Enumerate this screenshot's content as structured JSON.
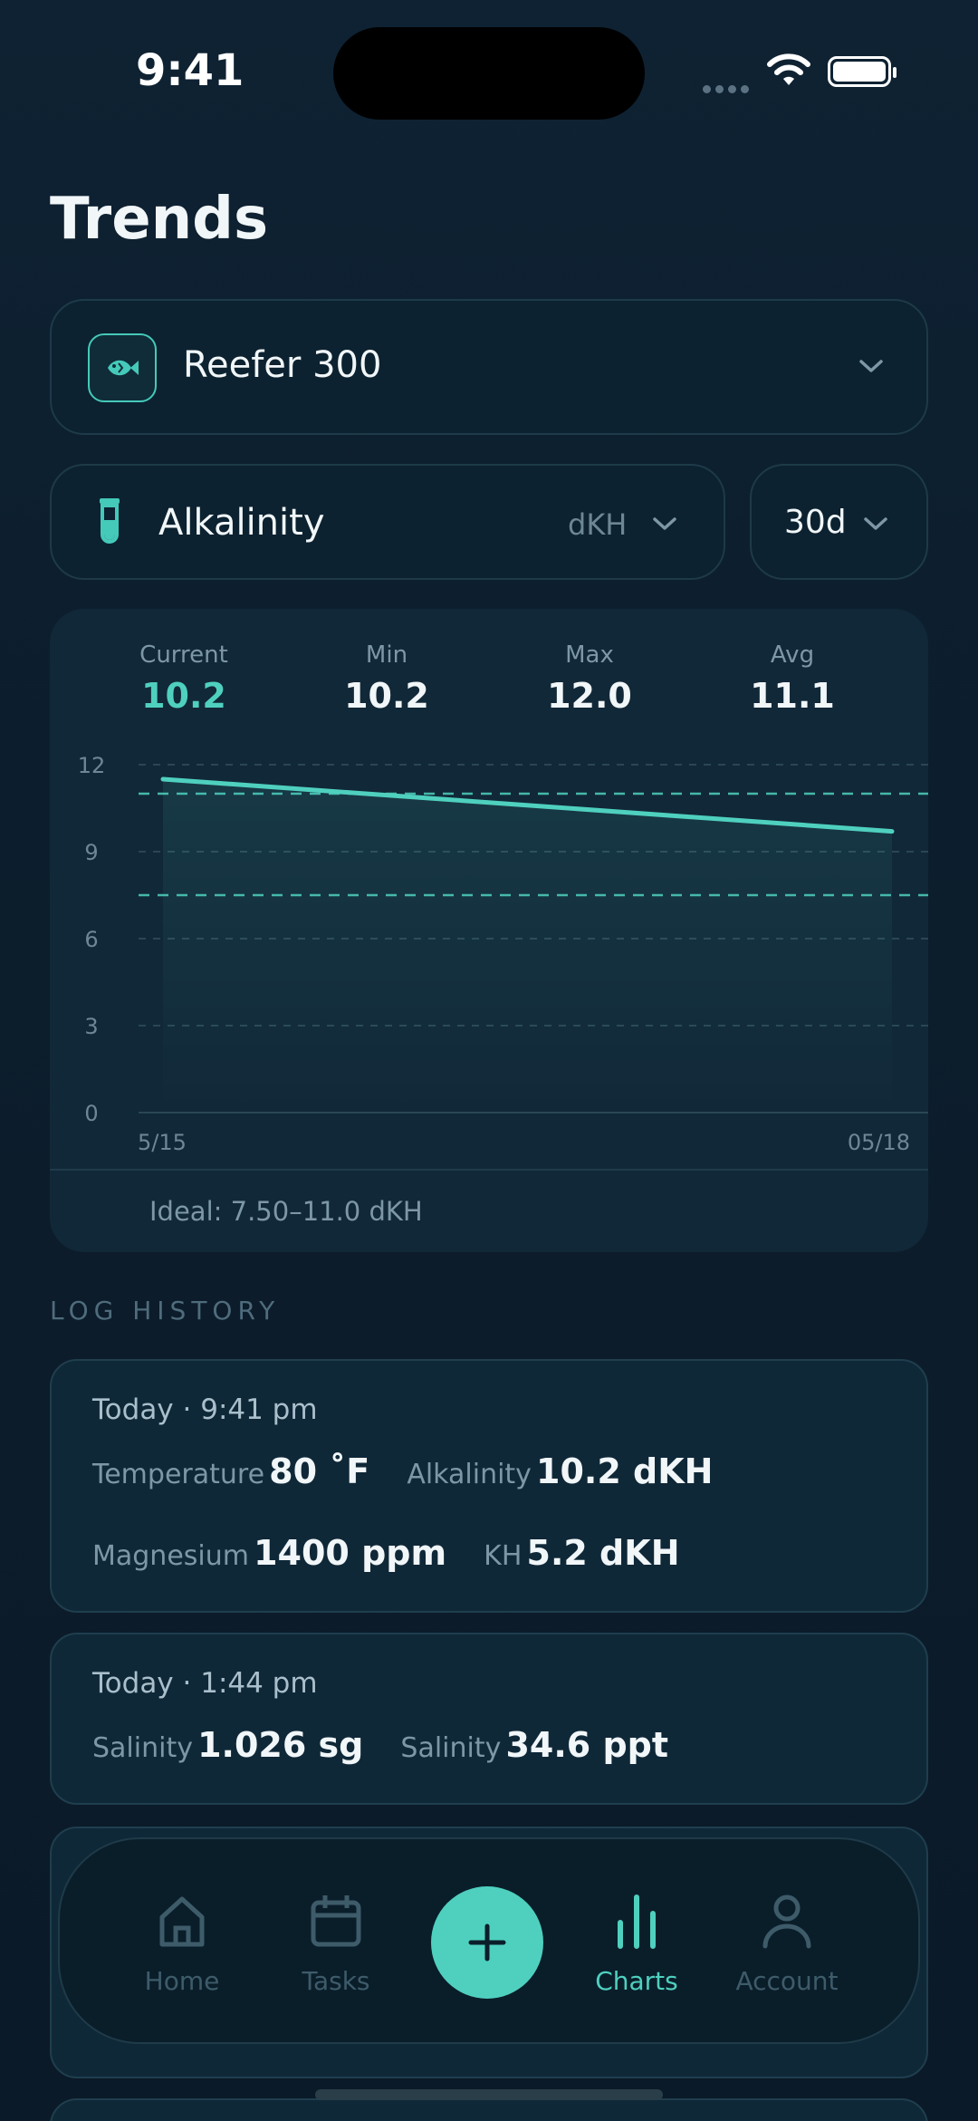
{
  "status_bar": {
    "time": "9:41"
  },
  "page": {
    "title": "Trends"
  },
  "tank_selector": {
    "name": "Reefer 300"
  },
  "parameter_selector": {
    "name": "Alkalinity",
    "unit": "dKH"
  },
  "range_selector": {
    "value": "30d"
  },
  "summary": {
    "current": {
      "label": "Current",
      "value": "10.2"
    },
    "min": {
      "label": "Min",
      "value": "10.2"
    },
    "max": {
      "label": "Max",
      "value": "12.0"
    },
    "avg": {
      "label": "Avg",
      "value": "11.1"
    }
  },
  "chart_data": {
    "type": "line",
    "x": [
      "5/15",
      "05/18"
    ],
    "x_tick_labels": [
      "5/15",
      "05/18"
    ],
    "series": [
      {
        "values": [
          11.5,
          9.7
        ]
      }
    ],
    "ylim": [
      0,
      12
    ],
    "y_ticks": [
      "0",
      "3",
      "6",
      "9",
      "12"
    ],
    "ideal_range": [
      7.5,
      11.0
    ],
    "ideal_label": "Ideal: 7.50–11.0 dKH",
    "grid": true,
    "line_color": "#4fd0bf"
  },
  "log_history": {
    "heading": "LOG HISTORY",
    "entries": [
      {
        "date": "Today · 9:41 pm",
        "readings": [
          {
            "label": "Temperature",
            "value": "80 ˚F"
          },
          {
            "label": "Alkalinity",
            "value": "10.2 dKH"
          },
          {
            "label": "Magnesium",
            "value": "1400 ppm"
          },
          {
            "label": "KH",
            "value": "5.2 dKH"
          }
        ]
      },
      {
        "date": "Today · 1:44 pm",
        "readings": [
          {
            "label": "Salinity",
            "value": "1.026 sg"
          },
          {
            "label": "Salinity",
            "value": "34.6 ppt"
          }
        ]
      }
    ]
  },
  "tab_bar": {
    "items": [
      {
        "label": "Home",
        "icon": "home-icon"
      },
      {
        "label": "Tasks",
        "icon": "calendar-icon"
      },
      {
        "label": "Charts",
        "icon": "bar-chart-icon",
        "active": true
      },
      {
        "label": "Account",
        "icon": "person-icon"
      }
    ],
    "add_icon": "plus-icon"
  },
  "colors": {
    "accent": "#4fd0bf",
    "background": "#0e2233",
    "card": "#112838"
  }
}
